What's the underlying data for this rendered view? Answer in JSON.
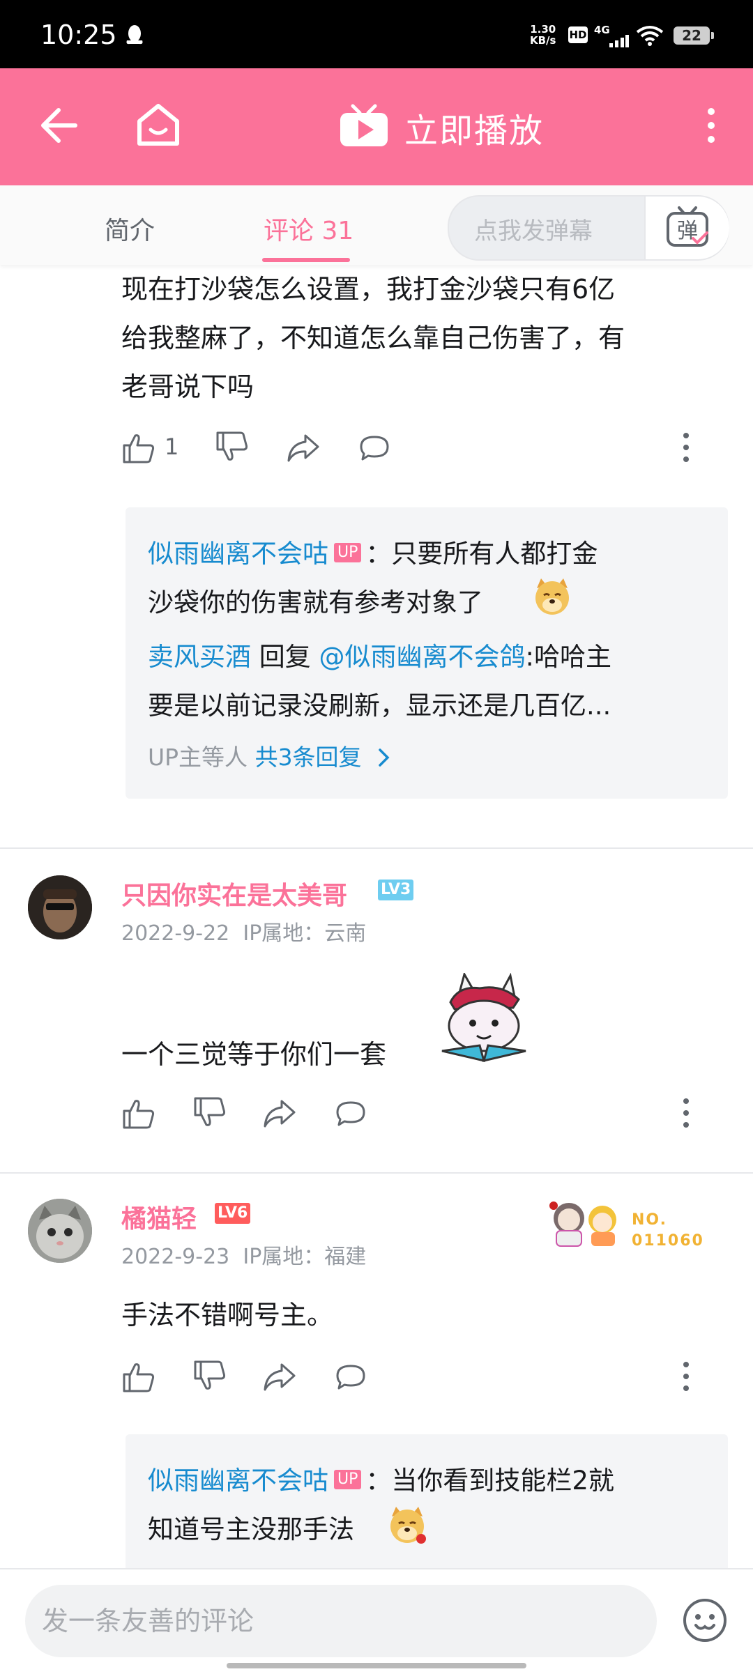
{
  "status": {
    "time": "10:25",
    "net_speed": "1.30",
    "net_speed_unit": "KB/s",
    "hd": "HD",
    "network": "4G",
    "battery": "22"
  },
  "header": {
    "play_now": "立即播放"
  },
  "tabs": {
    "intro": "简介",
    "comments": "评论 31"
  },
  "danmaku": {
    "placeholder": "点我发弹幕",
    "icon_char": "弹"
  },
  "comment0": {
    "lines": [
      "现在打沙袋怎么设置，我打金沙袋只有6亿",
      "给我整麻了，不知道怎么靠自己伤害了，有",
      "老哥说下吗"
    ],
    "likes": "1",
    "replies": [
      {
        "author": "似雨幽离不会咕",
        "badge": "UP",
        "line1": "：只要所有人都打金",
        "line2": "沙袋你的伤害就有参考对象了"
      },
      {
        "author": "卖风买酒",
        "verb": "回复",
        "target": "@似雨幽离不会鸽",
        "line1": ":哈哈主",
        "line2": "要是以前记录没刷新，显示还是几百亿..."
      }
    ],
    "more_prefix": "UP主等人",
    "more_link": "共3条回复"
  },
  "comment1": {
    "username": "只因你实在是太美哥",
    "level": "LV3",
    "date": "2022-9-22",
    "ip": "IP属地：云南",
    "text": "一个三觉等于你们一套"
  },
  "comment2": {
    "username": "橘猫轻",
    "level": "LV6",
    "date": "2022-9-23",
    "ip": "IP属地：福建",
    "fan_no_label": "NO.",
    "fan_no": "011060",
    "text": "手法不错啊号主。",
    "replies": [
      {
        "author": "似雨幽离不会咕",
        "badge": "UP",
        "line1": "：当你看到技能栏2就",
        "line2": "知道号主没那手法"
      }
    ]
  },
  "footer": {
    "comment_placeholder": "发一条友善的评论"
  },
  "colors": {
    "brand_pink": "#fb7299",
    "link_blue": "#178bcf",
    "text": "#18191c",
    "muted": "#9499a0",
    "reply_bg": "#f4f5f7",
    "lv3": "#6ecdf0",
    "lv6": "#ff5c5c"
  }
}
